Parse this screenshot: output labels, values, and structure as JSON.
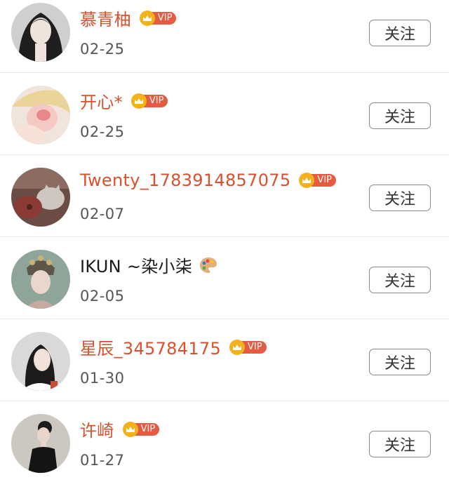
{
  "follow_label": "关注",
  "vip_label": "VIP",
  "colors": {
    "vip_name": "#d9512c",
    "vip_tag": "#e65a42",
    "crown": "#f3b21c"
  },
  "users": [
    {
      "name": "慕青柚",
      "date": "02-25",
      "vip": true
    },
    {
      "name": "开心*",
      "date": "02-25",
      "vip": true
    },
    {
      "name": "Twenty_1783914857075",
      "date": "02-07",
      "vip": true
    },
    {
      "name": "IKUN ~染小柒",
      "date": "02-05",
      "vip": false,
      "emoji_icon": "palette-icon"
    },
    {
      "name": "星辰_345784175",
      "date": "01-30",
      "vip": true
    },
    {
      "name": "许崎",
      "date": "01-27",
      "vip": true
    }
  ]
}
